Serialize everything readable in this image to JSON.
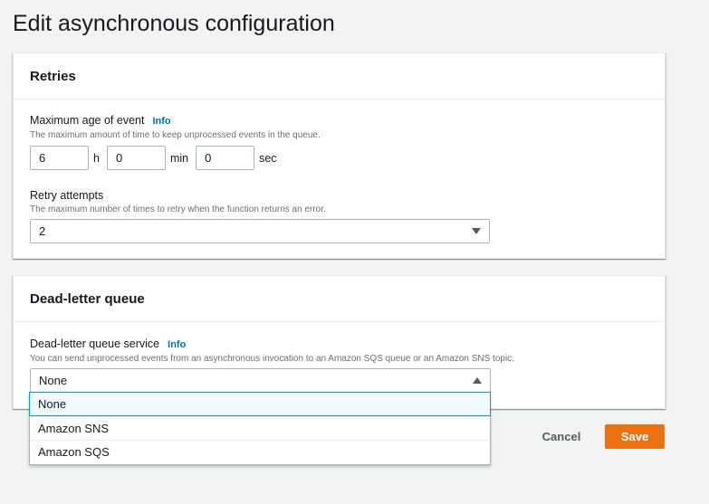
{
  "page": {
    "title": "Edit asynchronous configuration"
  },
  "retries": {
    "title": "Retries",
    "max_age": {
      "label": "Maximum age of event",
      "info": "Info",
      "description": "The maximum amount of time to keep unprocessed events in the queue.",
      "hours": "6",
      "hours_unit": "h",
      "minutes": "0",
      "minutes_unit": "min",
      "seconds": "0",
      "seconds_unit": "sec"
    },
    "retry_attempts": {
      "label": "Retry attempts",
      "description": "The maximum number of times to retry when the function returns an error.",
      "value": "2"
    }
  },
  "dlq": {
    "title": "Dead-letter queue",
    "service": {
      "label": "Dead-letter queue service",
      "info": "Info",
      "description": "You can send unprocessed events from an asynchronous invocation to an Amazon SQS queue or an Amazon SNS topic.",
      "value": "None",
      "options": [
        "None",
        "Amazon SNS",
        "Amazon SQS"
      ]
    }
  },
  "actions": {
    "cancel": "Cancel",
    "save": "Save"
  },
  "colors": {
    "accent": "#ec7211",
    "link": "#0073bb",
    "focus": "#00a1c9"
  },
  "icons": {
    "select_closed": "caret-down-icon",
    "select_open": "caret-up-icon"
  }
}
